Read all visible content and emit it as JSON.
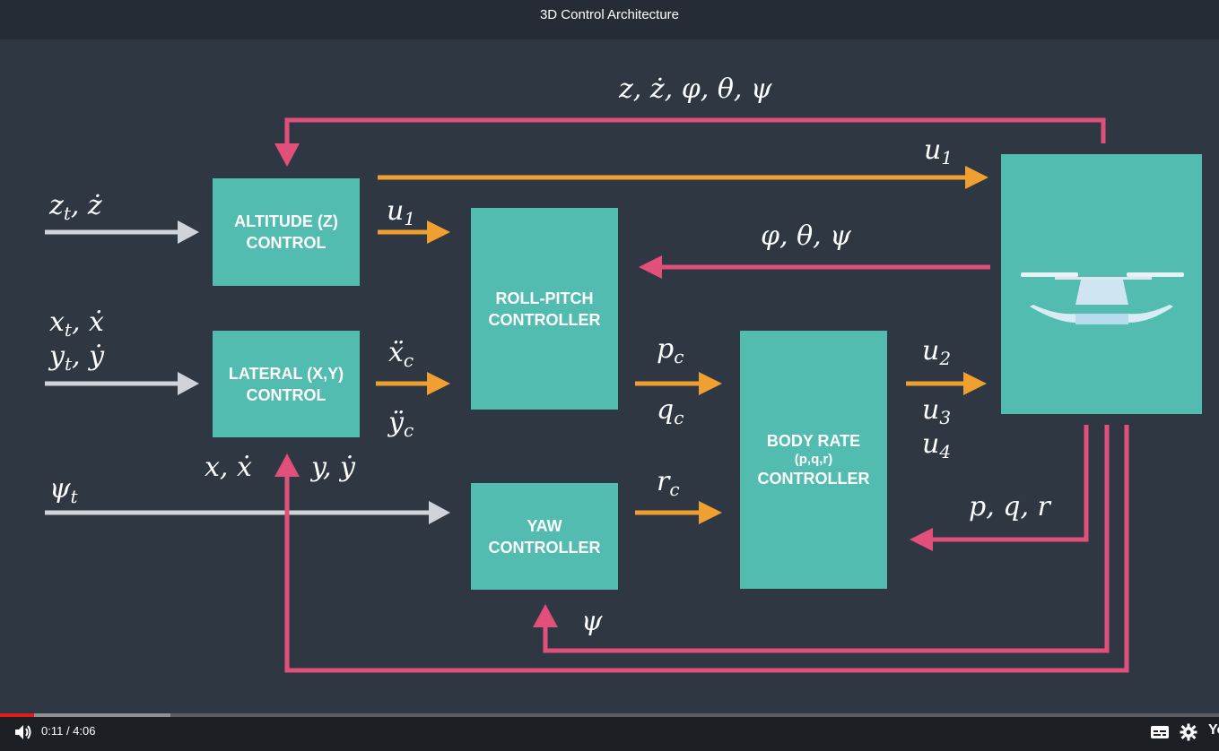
{
  "player": {
    "title": "3D Control Architecture",
    "time_display": "0:11 / 4:06",
    "brand_text": "Yo",
    "played_fraction": 0.028,
    "buffered_fraction": 0.14,
    "icons": [
      "volume-icon",
      "subtitles-icon",
      "settings-icon"
    ],
    "colors": {
      "played": "#e21b1b",
      "bar_bg": "#1c1f24"
    }
  },
  "diagram": {
    "colors": {
      "box": "#52bcb0",
      "feedback": "#e0507a",
      "control": "#f0a030",
      "input": "#d0d4da",
      "background": "#2f3743"
    },
    "boxes": {
      "altitude": [
        "ALTITUDE (Z)",
        "CONTROL"
      ],
      "lateral": [
        "LATERAL (X,Y)",
        "CONTROL"
      ],
      "roll_pitch": [
        "ROLL-PITCH",
        "CONTROLLER"
      ],
      "yaw": [
        "YAW",
        "CONTROLLER"
      ],
      "body_rate": [
        "BODY RATE",
        "(p,q,r)",
        "CONTROLLER"
      ]
    },
    "labels": {
      "top_feedback": "z, ż, φ, θ, ψ",
      "u1_top": "u",
      "u1_top_sub": "1",
      "zt": "z",
      "zt_sub": "t",
      "zt_dot": ", ż",
      "u1_mid": "u",
      "u1_mid_sub": "1",
      "angles_feedback": "φ, θ, ψ",
      "xt": "x",
      "xt_sub": "t",
      "xt_dot": ", ẋ",
      "yt": "y",
      "yt_sub": "t",
      "yt_dot": ", ẏ",
      "xc_ddot": "ẍ",
      "xc_sub": "c",
      "yc_ddot": "ÿ",
      "yc_sub": "c",
      "pc": "p",
      "pc_sub": "c",
      "qc": "q",
      "qc_sub": "c",
      "u2": "u",
      "u2_sub": "2",
      "u3": "u",
      "u3_sub": "3",
      "u4": "u",
      "u4_sub": "4",
      "x_xdot": "x, ẋ",
      "y_ydot": "y, ẏ",
      "psi_t": "ψ",
      "psi_t_sub": "t",
      "rc": "r",
      "rc_sub": "c",
      "pqr": "p, q, r",
      "psi": "ψ"
    }
  }
}
